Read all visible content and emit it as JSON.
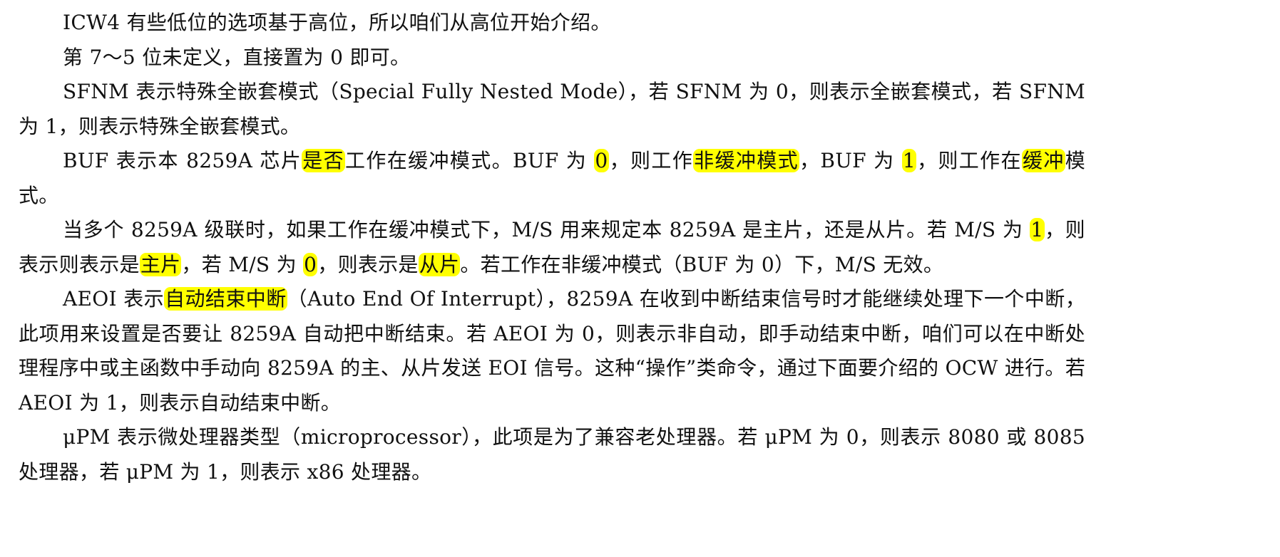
{
  "paragraphs": [
    {
      "name": "para-icw4-intro",
      "segments": [
        {
          "text": "ICW4 有些低位的选项基于高位，所以咱们从高位开始介绍。",
          "highlight": false
        }
      ]
    },
    {
      "name": "para-bits-7-5",
      "segments": [
        {
          "text": "第 7～5 位未定义，直接置为 0 即可。",
          "highlight": false
        }
      ]
    },
    {
      "name": "para-sfnm",
      "segments": [
        {
          "text": "SFNM 表示特殊全嵌套模式（Special Fully Nested Mode），若 SFNM 为 0，则表示全嵌套模式，若 SFNM 为 1，则表示特殊全嵌套模式。",
          "highlight": false
        }
      ]
    },
    {
      "name": "para-buf",
      "segments": [
        {
          "text": "BUF 表示本 8259A 芯片",
          "highlight": false
        },
        {
          "text": "是否",
          "highlight": true
        },
        {
          "text": "工作在缓冲模式。BUF 为 ",
          "highlight": false
        },
        {
          "text": "0",
          "highlight": true
        },
        {
          "text": "，则工作",
          "highlight": false
        },
        {
          "text": "非缓冲模式",
          "highlight": true
        },
        {
          "text": "，BUF 为 ",
          "highlight": false
        },
        {
          "text": "1",
          "highlight": true
        },
        {
          "text": "，则工作在",
          "highlight": false
        },
        {
          "text": "缓冲",
          "highlight": true
        },
        {
          "text": "模式。",
          "highlight": false
        }
      ]
    },
    {
      "name": "para-ms",
      "segments": [
        {
          "text": "当多个 8259A 级联时，如果工作在缓冲模式下，M/S 用来规定本 8259A 是主片，还是从片。若 M/S 为 ",
          "highlight": false
        },
        {
          "text": "1",
          "highlight": true
        },
        {
          "text": "，则表示则表示是",
          "highlight": false
        },
        {
          "text": "主片",
          "highlight": true
        },
        {
          "text": "，若 M/S 为 ",
          "highlight": false
        },
        {
          "text": "0",
          "highlight": true
        },
        {
          "text": "，则表示是",
          "highlight": false
        },
        {
          "text": "从片",
          "highlight": true
        },
        {
          "text": "。若工作在非缓冲模式（BUF 为 0）下，M/S 无效。",
          "highlight": false
        }
      ]
    },
    {
      "name": "para-aeoi",
      "segments": [
        {
          "text": "AEOI 表示",
          "highlight": false
        },
        {
          "text": "自动结束中断",
          "highlight": true
        },
        {
          "text": "（Auto End Of Interrupt），8259A 在收到中断结束信号时才能继续处理下一个中断，此项用来设置是否要让 8259A 自动把中断结束。若 AEOI 为 0，则表示非自动，即手动结束中断，咱们可以在中断处理程序中或主函数中手动向 8259A 的主、从片发送 EOI 信号。这种“操作”类命令，通过下面要介绍的 OCW 进行。若 AEOI 为 1，则表示自动结束中断。",
          "highlight": false
        }
      ]
    },
    {
      "name": "para-upm",
      "segments": [
        {
          "text": "μPM 表示微处理器类型（microprocessor），此项是为了兼容老处理器。若 μPM 为 0，则表示 8080 或 8085 处理器，若 μPM 为 1，则表示 x86 处理器。",
          "highlight": false
        }
      ]
    }
  ],
  "colors": {
    "highlight": "#ffff00",
    "text": "#111111",
    "background": "#ffffff"
  }
}
